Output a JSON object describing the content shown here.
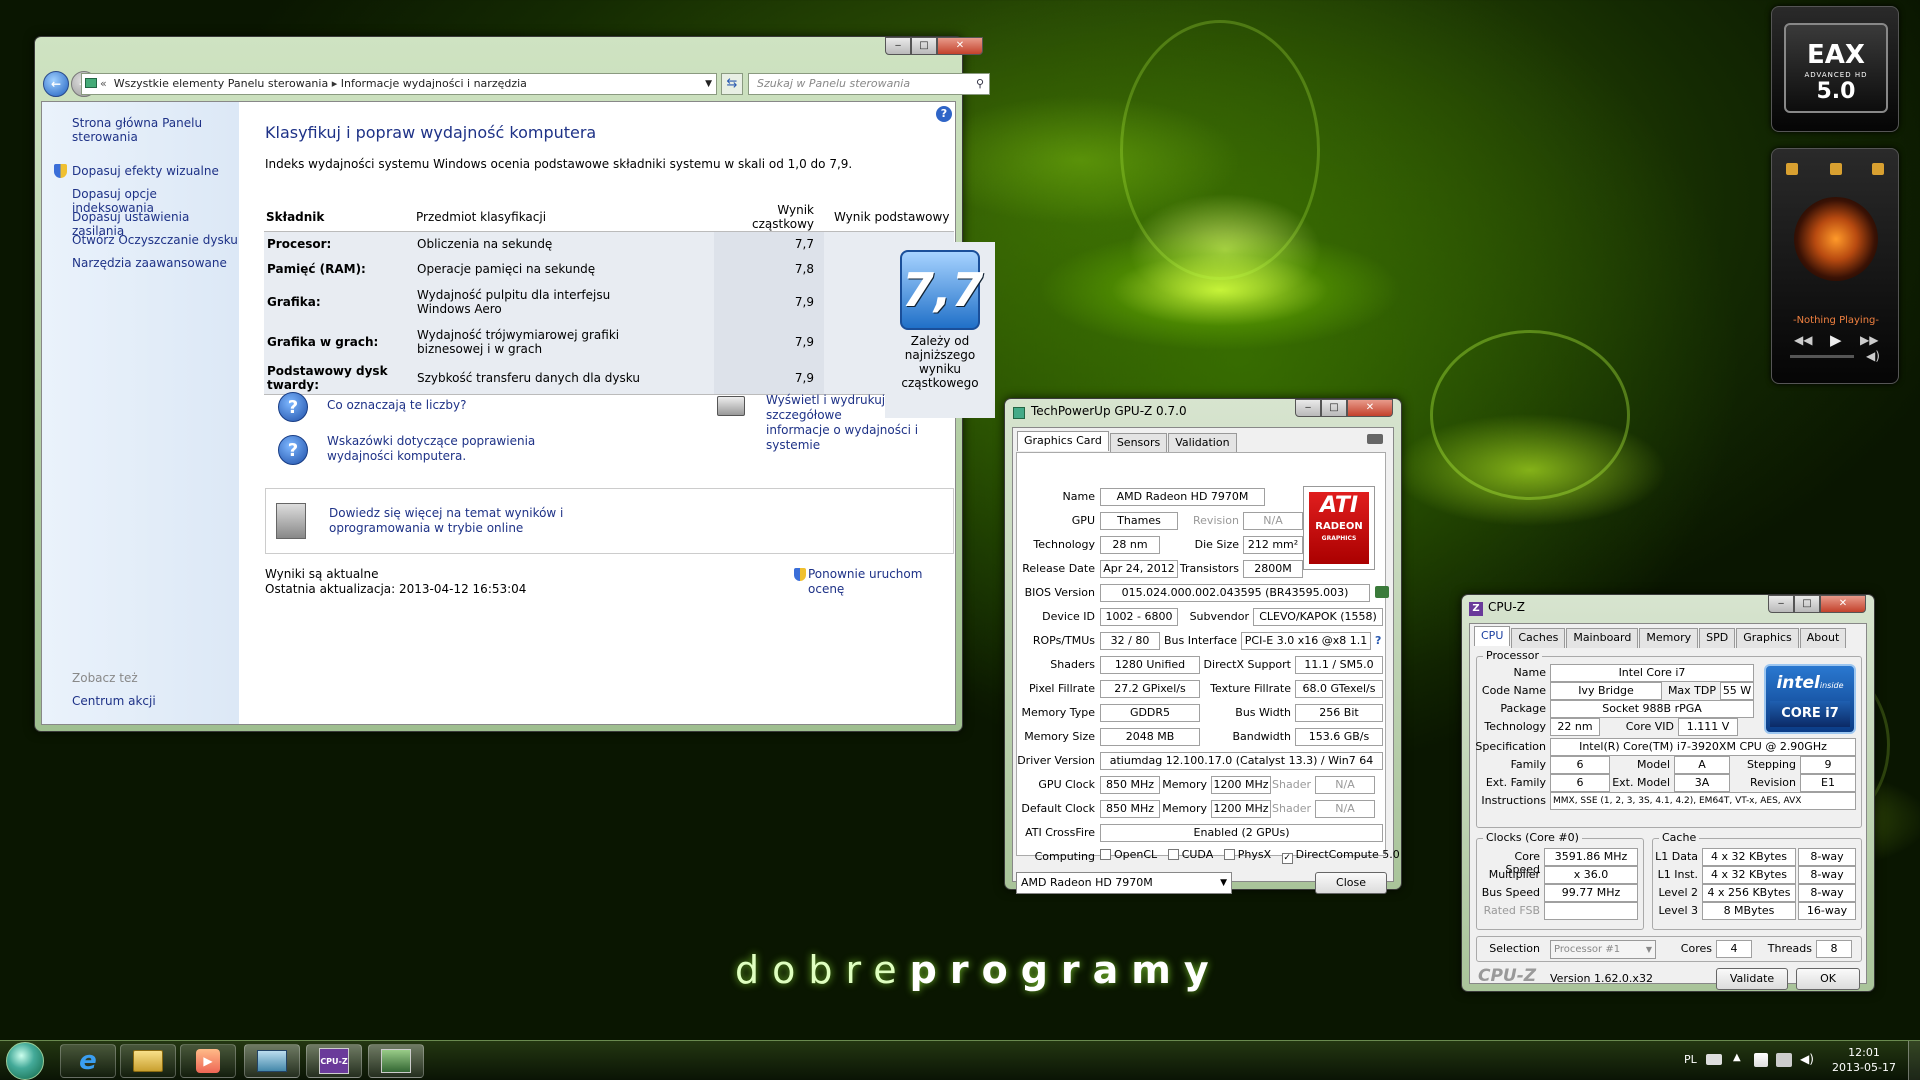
{
  "control_panel": {
    "breadcrumb_part1": "Wszystkie elementy Panelu sterowania",
    "breadcrumb_part2": "Informacje wydajności i narzędzia",
    "search_placeholder": "Szukaj w Panelu sterowania",
    "sidebar": {
      "home": "Strona główna Panelu",
      "home2": "sterowania",
      "items": [
        "Dopasuj efekty wizualne",
        "Dopasuj opcje indeksowania",
        "Dopasuj ustawienia zasilania",
        "Otwórz Oczyszczanie dysku",
        "Narzędzia zaawansowane"
      ],
      "see_also": "Zobacz też",
      "see_also_link": "Centrum akcji"
    },
    "title": "Klasyfikuj i popraw wydajność komputera",
    "intro": "Indeks wydajności systemu Windows ocenia podstawowe składniki systemu w skali od 1,0 do 7,9.",
    "columns": [
      "Składnik",
      "Przedmiot klasyfikacji",
      "Wynik cząstkowy",
      "Wynik podstawowy"
    ],
    "rows": [
      {
        "name": "Procesor:",
        "desc": "Obliczenia na sekundę",
        "desc2": "",
        "score": "7,7"
      },
      {
        "name": "Pamięć (RAM):",
        "desc": "Operacje pamięci na sekundę",
        "desc2": "",
        "score": "7,8"
      },
      {
        "name": "Grafika:",
        "desc": "Wydajność pulpitu dla interfejsu",
        "desc2": "Windows Aero",
        "score": "7,9"
      },
      {
        "name": "Grafika w grach:",
        "desc": "Wydajność trójwymiarowej grafiki",
        "desc2": "biznesowej i w grach",
        "score": "7,9"
      },
      {
        "name": "Podstawowy dysk twardy:",
        "desc": "Szybkość transferu danych dla dysku",
        "desc2": "",
        "score": "7,9"
      }
    ],
    "base_score": "7,7",
    "base_caption": [
      "Zależy od",
      "najniższego",
      "wyniku",
      "cząstkowego"
    ],
    "link_what": "Co oznaczają te liczby?",
    "link_tips1": "Wskazówki dotyczące poprawienia",
    "link_tips2": "wydajności komputera.",
    "link_print1": "Wyświetl i wydrukuj szczegółowe",
    "link_print2": "informacje o wydajności i systemie",
    "link_more1": "Dowiedz się więcej na temat wyników i",
    "link_more2": "oprogramowania w trybie online",
    "status1": "Wyniki są aktualne",
    "status2": "Ostatnia aktualizacja: 2013-04-12 16:53:04",
    "rerun": "Ponownie uruchom ocenę"
  },
  "gpuz": {
    "title": "TechPowerUp GPU-Z 0.7.0",
    "tabs": [
      "Graphics Card",
      "Sensors",
      "Validation"
    ],
    "name_label": "Name",
    "name": "AMD Radeon HD 7970M",
    "gpu_label": "GPU",
    "gpu": "Thames",
    "revision_label": "Revision",
    "revision": "N/A",
    "tech_label": "Technology",
    "tech": "28 nm",
    "die_label": "Die Size",
    "die": "212 mm²",
    "release_label": "Release Date",
    "release": "Apr 24, 2012",
    "trans_label": "Transistors",
    "trans": "2800M",
    "bios_label": "BIOS Version",
    "bios": "015.024.000.002.043595 (BR43595.003)",
    "devid_label": "Device ID",
    "devid": "1002 - 6800",
    "subv_label": "Subvendor",
    "subv": "CLEVO/KAPOK (1558)",
    "rops_label": "ROPs/TMUs",
    "rops": "32 / 80",
    "bus_label": "Bus Interface",
    "bus": "PCI-E 3.0 x16 @x8 1.1",
    "shaders_label": "Shaders",
    "shaders": "1280 Unified",
    "dx_label": "DirectX Support",
    "dx": "11.1 / SM5.0",
    "pixel_label": "Pixel Fillrate",
    "pixel": "27.2 GPixel/s",
    "tex_label": "Texture Fillrate",
    "tex": "68.0 GTexel/s",
    "memtype_label": "Memory Type",
    "memtype": "GDDR5",
    "buswidth_label": "Bus Width",
    "buswidth": "256 Bit",
    "memsize_label": "Memory Size",
    "memsize": "2048 MB",
    "bandwidth_label": "Bandwidth",
    "bandwidth": "153.6 GB/s",
    "driver_label": "Driver Version",
    "driver": "atiumdag 12.100.17.0 (Catalyst 13.3) / Win7 64",
    "gpuclock_label": "GPU Clock",
    "gpuclock": "850 MHz",
    "memory_label": "Memory",
    "memclock": "1200 MHz",
    "shader_label": "Shader",
    "shader": "N/A",
    "defclock_label": "Default Clock",
    "defclock": "850 MHz",
    "defmem": "1200 MHz",
    "defshader": "N/A",
    "crossfire_label": "ATI CrossFire",
    "crossfire": "Enabled (2 GPUs)",
    "computing_label": "Computing",
    "opencl": "OpenCL",
    "cuda": "CUDA",
    "physx": "PhysX",
    "dc": "DirectCompute 5.0",
    "select": "AMD Radeon HD 7970M",
    "close": "Close",
    "logo_top": "ATI",
    "logo_mid": "RADEON",
    "logo_bot": "GRAPHICS"
  },
  "cpuz": {
    "title": "CPU-Z",
    "tabs": [
      "CPU",
      "Caches",
      "Mainboard",
      "Memory",
      "SPD",
      "Graphics",
      "About"
    ],
    "processor_group": "Processor",
    "name_label": "Name",
    "name": "Intel Core i7",
    "code_label": "Code Name",
    "code": "Ivy Bridge",
    "tdp_label": "Max TDP",
    "tdp": "55 W",
    "pkg_label": "Package",
    "pkg": "Socket 988B rPGA",
    "tech_label": "Technology",
    "tech": "22 nm",
    "vid_label": "Core VID",
    "vid": "1.111 V",
    "spec_label": "Specification",
    "spec": "Intel(R) Core(TM) i7-3920XM CPU @ 2.90GHz",
    "family_label": "Family",
    "family": "6",
    "model_label": "Model",
    "model": "A",
    "stepping_label": "Stepping",
    "stepping": "9",
    "extfam_label": "Ext. Family",
    "extfam": "6",
    "extmodel_label": "Ext. Model",
    "extmodel": "3A",
    "revision_label": "Revision",
    "revision": "E1",
    "instr_label": "Instructions",
    "instr": "MMX, SSE (1, 2, 3, 3S, 4.1, 4.2), EM64T, VT-x, AES, AVX",
    "clocks_group": "Clocks (Core #0)",
    "speed_label": "Core Speed",
    "speed": "3591.86 MHz",
    "mult_label": "Multiplier",
    "mult": "x 36.0",
    "bus_label": "Bus Speed",
    "bus": "99.77 MHz",
    "fsb_label": "Rated FSB",
    "fsb": "",
    "cache_group": "Cache",
    "l1d_label": "L1 Data",
    "l1d": "4 x 32 KBytes",
    "l1d_w": "8-way",
    "l1i_label": "L1 Inst.",
    "l1i": "4 x 32 KBytes",
    "l1i_w": "8-way",
    "l2_label": "Level 2",
    "l2": "4 x 256 KBytes",
    "l2_w": "8-way",
    "l3_label": "Level 3",
    "l3": "8 MBytes",
    "l3_w": "16-way",
    "sel_label": "Selection",
    "sel": "Processor #1",
    "cores_label": "Cores",
    "cores": "4",
    "threads_label": "Threads",
    "threads": "8",
    "brand": "CPU-Z",
    "version": "Version 1.62.0.x32",
    "validate": "Validate",
    "ok": "OK",
    "intel_inside": "intel",
    "intel_inside2": "inside",
    "intel_core": "CORE i7"
  },
  "gadgets": {
    "eax": "EAX",
    "eax_sub": "ADVANCED HD",
    "eax_ver": "5.0",
    "player_status": "-Nothing Playing-"
  },
  "wallpaper_text_light": "dobre",
  "wallpaper_text_bold": "programy",
  "taskbar": {
    "lang": "PL",
    "time": "12:01",
    "date": "2013-05-17",
    "cpuz_icon": "CPU-Z"
  }
}
